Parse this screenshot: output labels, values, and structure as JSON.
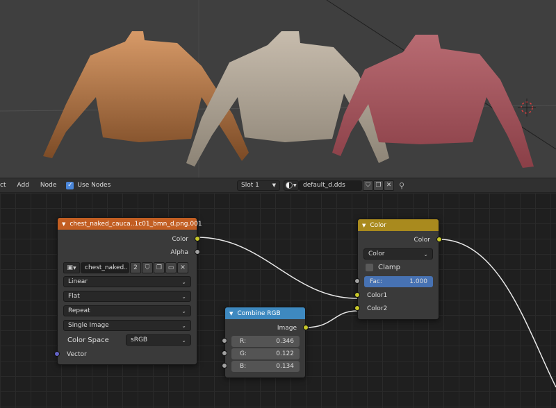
{
  "header": {
    "menu": [
      "ct",
      "Add",
      "Node"
    ],
    "use_nodes_label": "Use Nodes",
    "slot": "Slot 1",
    "material_name": "default_d.dds"
  },
  "nodes": {
    "image": {
      "title": "chest_naked_cauca..1c01_bmn_d.png.001",
      "outputs": [
        "Color",
        "Alpha"
      ],
      "image_name": "chest_naked..",
      "users": "2",
      "interpolation": "Linear",
      "projection": "Flat",
      "extension": "Repeat",
      "source": "Single Image",
      "color_space_label": "Color Space",
      "color_space": "sRGB",
      "input_label": "Vector"
    },
    "mix": {
      "title": "Color",
      "output_label": "Color",
      "blend_mode": "Color",
      "clamp_label": "Clamp",
      "fac_label": "Fac:",
      "fac_value": "1.000",
      "fac_fraction": 1.0,
      "color1_label": "Color1",
      "color2_label": "Color2"
    },
    "combine": {
      "title": "Combine RGB",
      "output_label": "Image",
      "r_label": "R:",
      "r_value": "0.346",
      "g_label": "G:",
      "g_value": "0.122",
      "b_label": "B:",
      "b_value": "0.134"
    }
  },
  "colors": {
    "image_header": "#c25e22",
    "mix_header": "#a98a1e",
    "combine_header": "#3e89c0",
    "fac_slider": "#4772b3"
  }
}
